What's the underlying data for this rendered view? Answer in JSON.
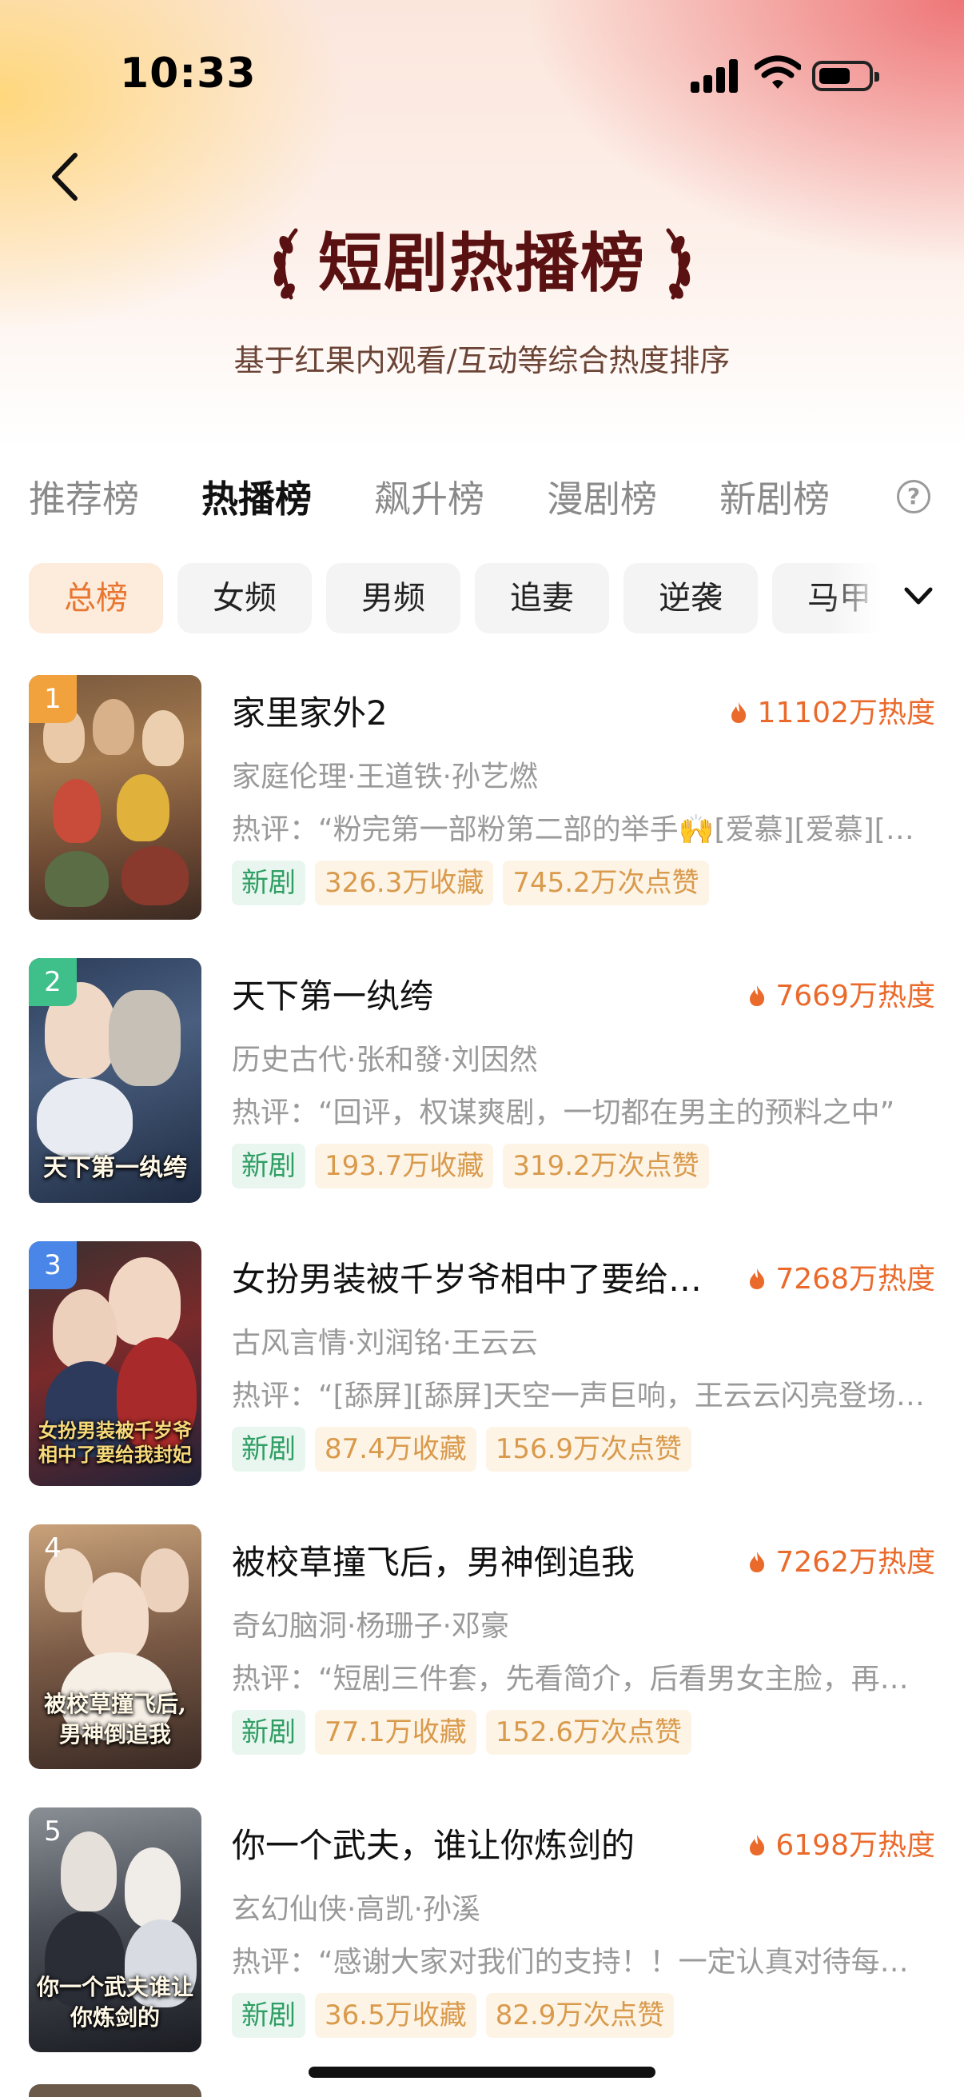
{
  "status_bar": {
    "time": "10:33"
  },
  "header": {
    "title": "短剧热播榜",
    "subtitle": "基于红果内观看/互动等综合热度排序"
  },
  "tabs": [
    {
      "label": "推荐榜",
      "active": false
    },
    {
      "label": "热播榜",
      "active": true
    },
    {
      "label": "飙升榜",
      "active": false
    },
    {
      "label": "漫剧榜",
      "active": false
    },
    {
      "label": "新剧榜",
      "active": false
    }
  ],
  "filters": [
    {
      "label": "总榜",
      "active": true
    },
    {
      "label": "女频",
      "active": false
    },
    {
      "label": "男频",
      "active": false
    },
    {
      "label": "追妻",
      "active": false
    },
    {
      "label": "逆袭",
      "active": false
    },
    {
      "label": "马甲",
      "active": false
    }
  ],
  "colors": {
    "accent_orange": "#ea6a2c",
    "title_brown": "#5a1111",
    "new_tag_green": "#2f9e64",
    "rank_1": "#f2a23c",
    "rank_2": "#3fbf8a",
    "rank_3": "#4a86e8",
    "rank_other": "transparent"
  },
  "list": [
    {
      "rank": "1",
      "title": "家里家外2",
      "heat": "11102万热度",
      "meta": "家庭伦理·王道铁·孙艺燃",
      "review": "热评：“粉完第一部粉第二部的举手🙌[爱慕][爱慕][爱慕]",
      "tags": {
        "new": "新剧",
        "favorites": "326.3万收藏",
        "likes": "745.2万次点赞"
      },
      "poster_caption": ""
    },
    {
      "rank": "2",
      "title": "天下第一纨绔",
      "heat": "7669万热度",
      "meta": "历史古代·张和發·刘因然",
      "review": "热评：“回评，权谋爽剧，一切都在男主的预料之中”",
      "tags": {
        "new": "新剧",
        "favorites": "193.7万收藏",
        "likes": "319.2万次点赞"
      },
      "poster_caption": "天下第一纨绔"
    },
    {
      "rank": "3",
      "title": "女扮男装被千岁爷相中了要给我封妃",
      "heat": "7268万热度",
      "meta": "古风言情·刘润铭·王云云",
      "review": "热评：“[舔屏][舔屏]天空一声巨响，王云云闪亮登场[舔屏]",
      "tags": {
        "new": "新剧",
        "favorites": "87.4万收藏",
        "likes": "156.9万次点赞"
      },
      "poster_caption": "女扮男装被千岁爷相中了要给我封妃"
    },
    {
      "rank": "4",
      "title": "被校草撞飞后，男神倒追我",
      "heat": "7262万热度",
      "meta": "奇幻脑洞·杨珊子·邓豪",
      "review": "热评：“短剧三件套，先看简介，后看男女主脸，再看评论",
      "tags": {
        "new": "新剧",
        "favorites": "77.1万收藏",
        "likes": "152.6万次点赞"
      },
      "poster_caption": "被校草撞飞后,男神倒追我"
    },
    {
      "rank": "5",
      "title": "你一个武夫，谁让你炼剑的",
      "heat": "6198万热度",
      "meta": "玄幻仙侠·高凯·孙溪",
      "review": "热评：“感谢大家对我们的支持！！一定认真对待每一部作品",
      "tags": {
        "new": "新剧",
        "favorites": "36.5万收藏",
        "likes": "82.9万次点赞"
      },
      "poster_caption": "你一个武夫谁让你炼剑的"
    }
  ]
}
